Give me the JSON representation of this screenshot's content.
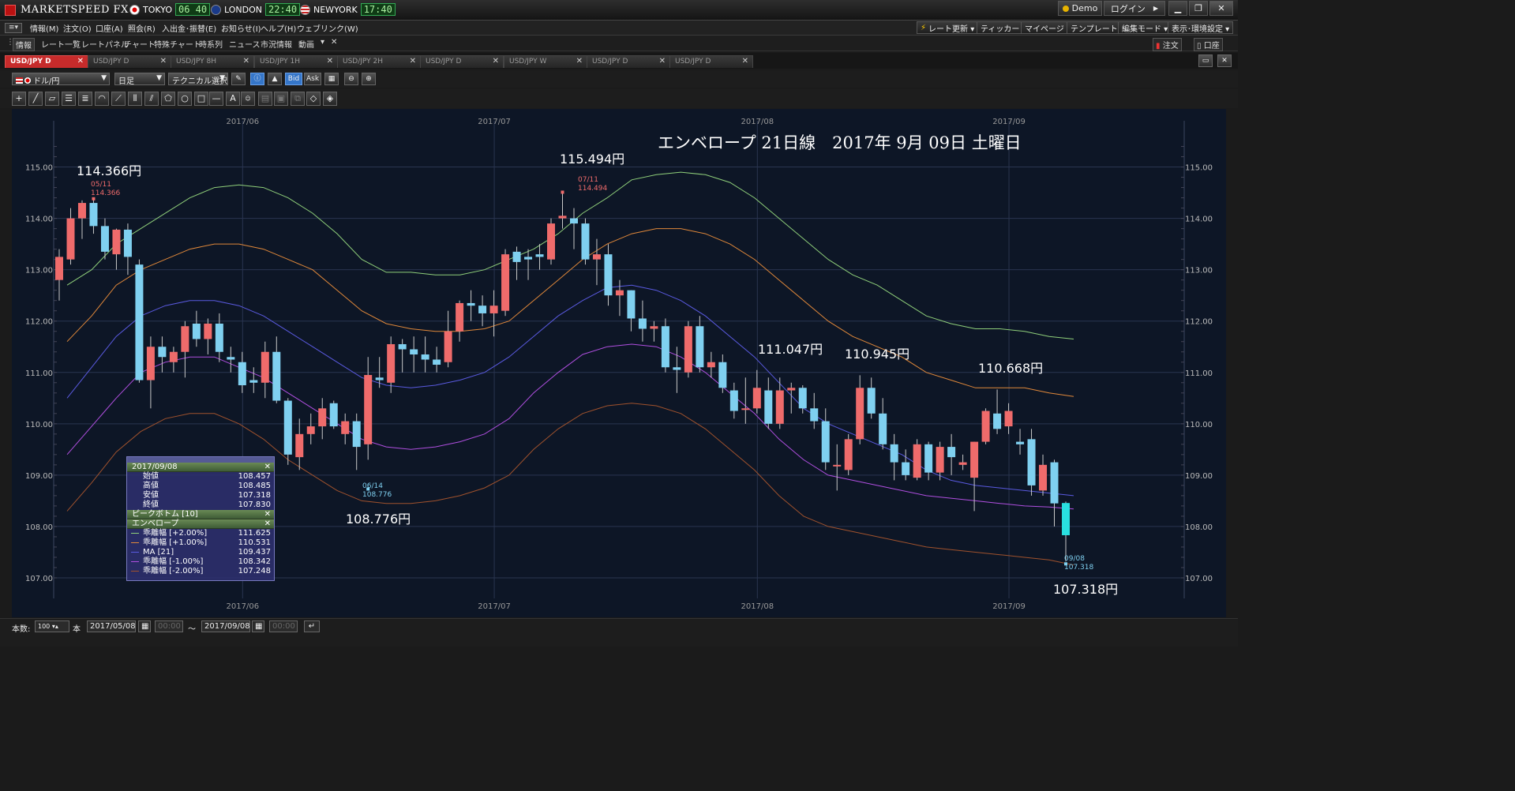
{
  "app": {
    "brand": "MARKETSPEED FX"
  },
  "clocks": [
    {
      "city": "TOKYO",
      "time": "06 40"
    },
    {
      "city": "LONDON",
      "time": "22:40"
    },
    {
      "city": "NEWYORK",
      "time": "17:40"
    }
  ],
  "window_buttons": {
    "demo": "Demo",
    "login": "ログイン"
  },
  "menu": [
    "情報(M)",
    "注文(O)",
    "口座(A)",
    "照会(R)",
    "入出金･振替(E)",
    "お知らせ(I)",
    "ヘルプ(H)",
    "ウェブリンク(W)"
  ],
  "menu_right": [
    "レート更新 ▾",
    "ティッカー ▾",
    "マイページ ▾",
    "テンプレート ▾",
    "編集モード ▾",
    "表示･環境設定 ▾"
  ],
  "toolbar2": [
    "情報",
    "レート一覧",
    "レートパネル",
    "チャート",
    "特殊チャート",
    "時系列",
    "ニュース",
    "市況情報",
    "動画"
  ],
  "toolbar2_right": [
    "注文",
    "口座"
  ],
  "tabs": [
    {
      "label": "USD/JPY D",
      "active": true
    },
    {
      "label": "USD/JPY D",
      "active": false
    },
    {
      "label": "USD/JPY 8H",
      "active": false
    },
    {
      "label": "USD/JPY 1H",
      "active": false
    },
    {
      "label": "USD/JPY 2H",
      "active": false
    },
    {
      "label": "USD/JPY D",
      "active": false
    },
    {
      "label": "USD/JPY W",
      "active": false
    },
    {
      "label": "USD/JPY D",
      "active": false
    },
    {
      "label": "USD/JPY D",
      "active": false
    }
  ],
  "controls": {
    "pair": "ドル/円",
    "period": "日足",
    "technical": "テクニカル選択",
    "bid": "Bid",
    "ask": "Ask"
  },
  "bottom": {
    "count_label": "本数:",
    "count_value": "100",
    "count_unit": "本",
    "date_from": "2017/05/08",
    "time_from": "00:00",
    "tilde": "～",
    "date_to": "2017/09/08",
    "time_to": "00:00"
  },
  "info_panel": {
    "date": "2017/09/08",
    "ohlc": [
      {
        "label": "始値",
        "value": "108.457"
      },
      {
        "label": "高値",
        "value": "108.485"
      },
      {
        "label": "安値",
        "value": "107.318"
      },
      {
        "label": "終値",
        "value": "107.830"
      }
    ],
    "peak_bottom": "ピークボトム [10]",
    "envelope": "エンベロープ",
    "lines": [
      {
        "label": "乖離幅 [+2.00%]",
        "value": "111.625",
        "color": "#8fcf7a"
      },
      {
        "label": "乖離幅 [+1.00%]",
        "value": "110.531",
        "color": "#e0883a"
      },
      {
        "label": "MA [21]",
        "value": "109.437",
        "color": "#5a5ae0"
      },
      {
        "label": "乖離幅 [-1.00%]",
        "value": "108.342",
        "color": "#b04fe0"
      },
      {
        "label": "乖離幅 [-2.00%]",
        "value": "107.248",
        "color": "#a0522d"
      }
    ]
  },
  "chart_data": {
    "type": "candlestick",
    "title": "エンベロープ 21日線　2017年 9月 09日 土曜日",
    "ylim": [
      106.6,
      115.9
    ],
    "y_ticks": [
      "115.00",
      "114.00",
      "113.00",
      "112.00",
      "111.00",
      "110.00",
      "109.00",
      "108.00",
      "107.00"
    ],
    "x_labels": [
      "2017/06",
      "2017/07",
      "2017/08",
      "2017/09"
    ],
    "candles": [
      {
        "o": 112.8,
        "h": 113.4,
        "l": 112.4,
        "c": 113.25
      },
      {
        "o": 113.2,
        "h": 114.2,
        "l": 113.1,
        "c": 114.0
      },
      {
        "o": 114.0,
        "h": 114.35,
        "l": 113.6,
        "c": 114.3
      },
      {
        "o": 114.3,
        "h": 114.366,
        "l": 113.7,
        "c": 113.85
      },
      {
        "o": 113.85,
        "h": 114.0,
        "l": 113.2,
        "c": 113.35
      },
      {
        "o": 113.3,
        "h": 113.8,
        "l": 113.0,
        "c": 113.78
      },
      {
        "o": 113.78,
        "h": 113.9,
        "l": 112.9,
        "c": 113.25
      },
      {
        "o": 113.1,
        "h": 113.2,
        "l": 110.8,
        "c": 110.85
      },
      {
        "o": 110.85,
        "h": 111.7,
        "l": 110.3,
        "c": 111.5
      },
      {
        "o": 111.5,
        "h": 111.7,
        "l": 111.0,
        "c": 111.3
      },
      {
        "o": 111.2,
        "h": 111.5,
        "l": 111.0,
        "c": 111.4
      },
      {
        "o": 111.4,
        "h": 112.0,
        "l": 110.9,
        "c": 111.9
      },
      {
        "o": 111.95,
        "h": 112.2,
        "l": 111.5,
        "c": 111.65
      },
      {
        "o": 111.65,
        "h": 112.05,
        "l": 111.35,
        "c": 111.95
      },
      {
        "o": 111.95,
        "h": 112.15,
        "l": 111.2,
        "c": 111.4
      },
      {
        "o": 111.3,
        "h": 111.5,
        "l": 111.0,
        "c": 111.25
      },
      {
        "o": 111.2,
        "h": 111.4,
        "l": 110.6,
        "c": 110.75
      },
      {
        "o": 110.85,
        "h": 111.1,
        "l": 110.6,
        "c": 110.8
      },
      {
        "o": 110.8,
        "h": 111.6,
        "l": 110.5,
        "c": 111.4
      },
      {
        "o": 111.4,
        "h": 111.7,
        "l": 110.4,
        "c": 110.45
      },
      {
        "o": 110.45,
        "h": 110.5,
        "l": 109.2,
        "c": 109.4
      },
      {
        "o": 109.35,
        "h": 110.1,
        "l": 109.1,
        "c": 109.8
      },
      {
        "o": 109.8,
        "h": 110.2,
        "l": 109.6,
        "c": 109.95
      },
      {
        "o": 109.95,
        "h": 110.5,
        "l": 109.7,
        "c": 110.3
      },
      {
        "o": 110.4,
        "h": 110.45,
        "l": 109.9,
        "c": 109.95
      },
      {
        "o": 109.8,
        "h": 110.2,
        "l": 109.6,
        "c": 110.05
      },
      {
        "o": 110.05,
        "h": 110.2,
        "l": 109.1,
        "c": 109.55
      },
      {
        "o": 109.6,
        "h": 111.3,
        "l": 109.3,
        "c": 110.95
      },
      {
        "o": 110.9,
        "h": 111.3,
        "l": 110.7,
        "c": 110.85
      },
      {
        "o": 110.8,
        "h": 111.7,
        "l": 110.6,
        "c": 111.55
      },
      {
        "o": 111.55,
        "h": 111.65,
        "l": 111.0,
        "c": 111.45
      },
      {
        "o": 111.45,
        "h": 111.7,
        "l": 111.0,
        "c": 111.35
      },
      {
        "o": 111.35,
        "h": 111.7,
        "l": 111.0,
        "c": 111.25
      },
      {
        "o": 111.25,
        "h": 111.5,
        "l": 111.0,
        "c": 111.15
      },
      {
        "o": 111.2,
        "h": 112.2,
        "l": 111.1,
        "c": 111.8
      },
      {
        "o": 111.8,
        "h": 112.4,
        "l": 111.6,
        "c": 112.35
      },
      {
        "o": 112.35,
        "h": 112.6,
        "l": 112.0,
        "c": 112.3
      },
      {
        "o": 112.3,
        "h": 112.5,
        "l": 111.9,
        "c": 112.15
      },
      {
        "o": 112.15,
        "h": 112.6,
        "l": 111.7,
        "c": 112.3
      },
      {
        "o": 112.2,
        "h": 113.4,
        "l": 112.1,
        "c": 113.3
      },
      {
        "o": 113.35,
        "h": 113.45,
        "l": 112.8,
        "c": 113.15
      },
      {
        "o": 113.25,
        "h": 113.4,
        "l": 112.8,
        "c": 113.2
      },
      {
        "o": 113.3,
        "h": 113.5,
        "l": 113.0,
        "c": 113.25
      },
      {
        "o": 113.2,
        "h": 114.0,
        "l": 113.1,
        "c": 113.9
      },
      {
        "o": 114.0,
        "h": 114.494,
        "l": 113.8,
        "c": 114.05
      },
      {
        "o": 114.0,
        "h": 114.2,
        "l": 113.4,
        "c": 113.9
      },
      {
        "o": 113.9,
        "h": 114.0,
        "l": 113.1,
        "c": 113.2
      },
      {
        "o": 113.2,
        "h": 113.6,
        "l": 112.7,
        "c": 113.3
      },
      {
        "o": 113.3,
        "h": 113.5,
        "l": 112.3,
        "c": 112.5
      },
      {
        "o": 112.5,
        "h": 112.8,
        "l": 112.1,
        "c": 112.6
      },
      {
        "o": 112.6,
        "h": 112.6,
        "l": 111.8,
        "c": 112.05
      },
      {
        "o": 112.05,
        "h": 112.4,
        "l": 111.6,
        "c": 111.85
      },
      {
        "o": 111.85,
        "h": 112.0,
        "l": 111.6,
        "c": 111.9
      },
      {
        "o": 111.9,
        "h": 112.05,
        "l": 111.0,
        "c": 111.1
      },
      {
        "o": 111.1,
        "h": 111.5,
        "l": 110.6,
        "c": 111.05
      },
      {
        "o": 111.0,
        "h": 112.0,
        "l": 110.9,
        "c": 111.9
      },
      {
        "o": 111.9,
        "h": 112.1,
        "l": 111.0,
        "c": 111.1
      },
      {
        "o": 111.1,
        "h": 111.4,
        "l": 110.9,
        "c": 111.2
      },
      {
        "o": 111.2,
        "h": 111.35,
        "l": 110.6,
        "c": 110.7
      },
      {
        "o": 110.65,
        "h": 110.8,
        "l": 110.1,
        "c": 110.25
      },
      {
        "o": 110.3,
        "h": 110.9,
        "l": 110.0,
        "c": 110.3
      },
      {
        "o": 110.3,
        "h": 111.047,
        "l": 110.2,
        "c": 110.7
      },
      {
        "o": 110.65,
        "h": 110.9,
        "l": 109.9,
        "c": 110.0
      },
      {
        "o": 110.0,
        "h": 110.9,
        "l": 109.9,
        "c": 110.65
      },
      {
        "o": 110.65,
        "h": 110.8,
        "l": 110.2,
        "c": 110.7
      },
      {
        "o": 110.7,
        "h": 110.75,
        "l": 110.2,
        "c": 110.3
      },
      {
        "o": 110.3,
        "h": 110.6,
        "l": 109.9,
        "c": 110.05
      },
      {
        "o": 110.05,
        "h": 110.3,
        "l": 109.1,
        "c": 109.25
      },
      {
        "o": 109.2,
        "h": 109.6,
        "l": 108.7,
        "c": 109.2
      },
      {
        "o": 109.1,
        "h": 109.8,
        "l": 109.0,
        "c": 109.7
      },
      {
        "o": 109.7,
        "h": 110.945,
        "l": 109.6,
        "c": 110.7
      },
      {
        "o": 110.7,
        "h": 110.9,
        "l": 110.1,
        "c": 110.2
      },
      {
        "o": 110.2,
        "h": 110.5,
        "l": 109.5,
        "c": 109.6
      },
      {
        "o": 109.6,
        "h": 109.8,
        "l": 108.9,
        "c": 109.25
      },
      {
        "o": 109.25,
        "h": 109.5,
        "l": 108.9,
        "c": 109.0
      },
      {
        "o": 108.95,
        "h": 109.7,
        "l": 108.9,
        "c": 109.6
      },
      {
        "o": 109.6,
        "h": 109.65,
        "l": 108.9,
        "c": 109.05
      },
      {
        "o": 109.05,
        "h": 109.65,
        "l": 108.9,
        "c": 109.55
      },
      {
        "o": 109.55,
        "h": 109.8,
        "l": 109.0,
        "c": 109.35
      },
      {
        "o": 109.2,
        "h": 109.4,
        "l": 109.1,
        "c": 109.25
      },
      {
        "o": 108.95,
        "h": 109.65,
        "l": 108.3,
        "c": 109.65
      },
      {
        "o": 109.65,
        "h": 110.3,
        "l": 109.6,
        "c": 110.25
      },
      {
        "o": 110.2,
        "h": 110.668,
        "l": 109.8,
        "c": 109.9
      },
      {
        "o": 109.95,
        "h": 110.4,
        "l": 109.8,
        "c": 110.25
      },
      {
        "o": 109.65,
        "h": 109.9,
        "l": 109.4,
        "c": 109.6
      },
      {
        "o": 109.7,
        "h": 109.9,
        "l": 108.6,
        "c": 108.8
      },
      {
        "o": 108.7,
        "h": 109.4,
        "l": 108.6,
        "c": 109.2
      },
      {
        "o": 109.25,
        "h": 109.3,
        "l": 108.0,
        "c": 108.45
      },
      {
        "o": 108.457,
        "h": 108.485,
        "l": 107.318,
        "c": 107.83
      }
    ],
    "envelope": {
      "plus2": [
        112.7,
        113.0,
        113.5,
        113.8,
        114.1,
        114.4,
        114.6,
        114.65,
        114.6,
        114.4,
        114.1,
        113.7,
        113.2,
        112.95,
        112.95,
        112.9,
        112.9,
        113.0,
        113.2,
        113.4,
        113.7,
        114.1,
        114.4,
        114.75,
        114.85,
        114.9,
        114.85,
        114.7,
        114.4,
        114.0,
        113.6,
        113.2,
        112.9,
        112.7,
        112.4,
        112.1,
        111.95,
        111.85,
        111.85,
        111.8,
        111.7,
        111.65
      ],
      "plus1": [
        111.6,
        112.1,
        112.7,
        113.0,
        113.2,
        113.4,
        113.5,
        113.5,
        113.4,
        113.2,
        113.0,
        112.6,
        112.2,
        111.95,
        111.85,
        111.8,
        111.8,
        111.85,
        112.0,
        112.4,
        112.8,
        113.2,
        113.5,
        113.7,
        113.8,
        113.8,
        113.7,
        113.5,
        113.2,
        112.8,
        112.4,
        112.0,
        111.7,
        111.5,
        111.3,
        111.0,
        110.85,
        110.7,
        110.7,
        110.7,
        110.6,
        110.53
      ],
      "ma": [
        110.5,
        111.1,
        111.7,
        112.1,
        112.3,
        112.4,
        112.4,
        112.3,
        112.1,
        111.8,
        111.5,
        111.2,
        110.9,
        110.75,
        110.7,
        110.75,
        110.85,
        111.0,
        111.3,
        111.7,
        112.1,
        112.4,
        112.65,
        112.7,
        112.6,
        112.4,
        112.1,
        111.7,
        111.3,
        110.8,
        110.3,
        110.0,
        109.8,
        109.6,
        109.4,
        109.1,
        108.9,
        108.8,
        108.75,
        108.7,
        108.65,
        108.6
      ],
      "minus1": [
        109.4,
        109.95,
        110.5,
        111.0,
        111.2,
        111.3,
        111.3,
        111.1,
        110.9,
        110.6,
        110.3,
        110.0,
        109.7,
        109.55,
        109.5,
        109.55,
        109.65,
        109.8,
        110.1,
        110.6,
        111.0,
        111.35,
        111.5,
        111.55,
        111.5,
        111.3,
        111.0,
        110.6,
        110.2,
        109.7,
        109.3,
        109.0,
        108.9,
        108.8,
        108.7,
        108.6,
        108.55,
        108.5,
        108.45,
        108.4,
        108.38,
        108.34
      ],
      "minus2": [
        108.3,
        108.85,
        109.45,
        109.85,
        110.1,
        110.2,
        110.2,
        110.0,
        109.7,
        109.3,
        109.0,
        108.7,
        108.5,
        108.45,
        108.45,
        108.5,
        108.6,
        108.75,
        109.0,
        109.5,
        109.9,
        110.2,
        110.35,
        110.4,
        110.35,
        110.2,
        109.9,
        109.5,
        109.1,
        108.6,
        108.2,
        108.0,
        107.9,
        107.8,
        107.7,
        107.6,
        107.55,
        107.5,
        107.45,
        107.4,
        107.35,
        107.25
      ]
    },
    "annotations": [
      {
        "text": "114.366円",
        "date": "05/11",
        "value": "114.366",
        "kind": "high"
      },
      {
        "text": "115.494円",
        "date": "07/11",
        "value": "114.494",
        "kind": "high"
      },
      {
        "text": "108.776円",
        "date": "06/14",
        "value": "108.776",
        "kind": "low"
      },
      {
        "text": "111.047円",
        "kind": "plain"
      },
      {
        "text": "110.945円",
        "kind": "plain"
      },
      {
        "text": "110.668円",
        "kind": "plain"
      },
      {
        "text": "107.318円",
        "date": "09/08",
        "value": "107.318",
        "kind": "low"
      }
    ]
  }
}
